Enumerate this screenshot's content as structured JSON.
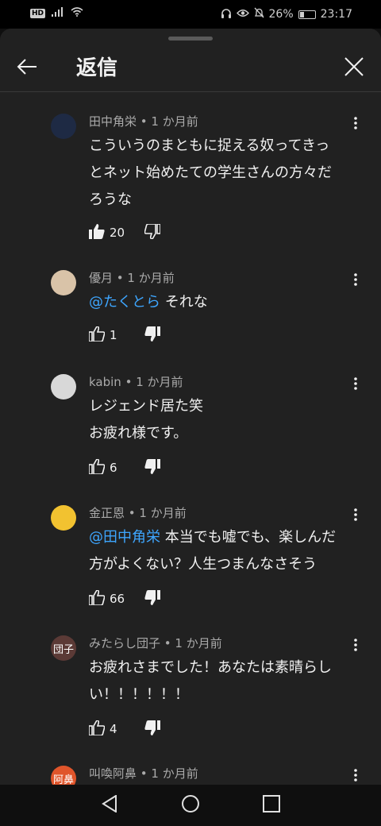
{
  "status_bar": {
    "hd_label": "HD",
    "battery_percent": "26%",
    "battery_level": 0.26,
    "time": "23:17"
  },
  "header": {
    "title": "返信"
  },
  "comments": [
    {
      "author_meta": "田中角栄 • 1 か月前",
      "lines": [
        "こういうのまともに捉える奴ってきっ",
        "とネット始めたての学生さんの方々だ",
        "ろうな"
      ],
      "likes": "20",
      "like_state": "liked",
      "avatar_color": "#1e2a44"
    },
    {
      "author_meta": "優月 • 1 か月前",
      "mention": "@たくとら",
      "lines_after_mention": [
        " それな"
      ],
      "likes": "1",
      "like_state": "disliked",
      "avatar_color": "#d9c3a8"
    },
    {
      "author_meta": "kabin • 1 か月前",
      "lines": [
        "レジェンド居た笑",
        "お疲れ様です。"
      ],
      "likes": "6",
      "like_state": "disliked",
      "avatar_color": "#d8d8d8"
    },
    {
      "author_meta": "金正恩 • 1 か月前",
      "mention": "@田中角栄",
      "lines_after_mention": [
        " 本当でも嘘でも、楽しんだ",
        "方がよくない？人生つまんなさそう"
      ],
      "likes": "66",
      "like_state": "disliked",
      "avatar_color": "#f2c230"
    },
    {
      "author_meta": "みたらし団子 • 1 か月前",
      "avatar_text": "団子",
      "lines": [
        "お疲れさまでした！あなたは素晴らし",
        "い！！！！！！"
      ],
      "likes": "4",
      "like_state": "disliked",
      "avatar_color": "#5b3a36"
    },
    {
      "author_meta": "叫喚阿鼻 • 1 か月前",
      "avatar_text": "阿鼻",
      "avatar_color": "#e0552b"
    }
  ],
  "icons": {
    "back": "arrow-left-icon",
    "close": "close-icon",
    "more": "more-vert-icon",
    "like": "thumb-up-icon",
    "dislike": "thumb-down-icon"
  }
}
